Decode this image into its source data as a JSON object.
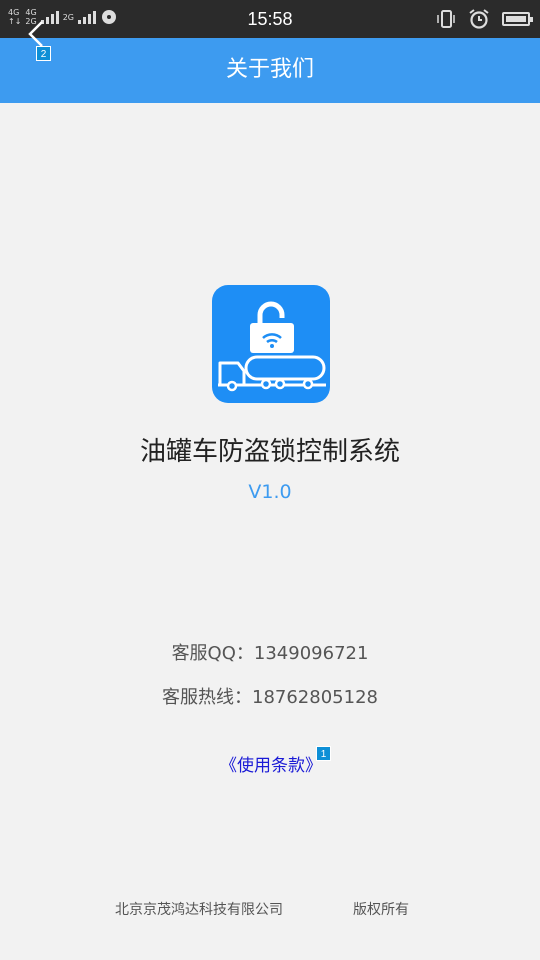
{
  "status_bar": {
    "network_1": "4G",
    "network_2": "4G",
    "network_3": "2G",
    "network_4": "2G",
    "time": "15:58"
  },
  "header": {
    "title": "关于我们",
    "back_badge": "2"
  },
  "app": {
    "icon_name": "oil-tanker-lock-wifi-icon",
    "name": "油罐车防盗锁控制系统",
    "version": "V1.0"
  },
  "contact": {
    "qq": "客服QQ：1349096721",
    "hotline": "客服热线：18762805128"
  },
  "terms": {
    "label": "《使用条款》",
    "badge": "1"
  },
  "footer": {
    "company": "北京京茂鸿达科技有限公司",
    "rights": "版权所有"
  },
  "colors": {
    "accent": "#3d9bf0",
    "status_bar": "#2b2b2b",
    "link": "#1a1ad6",
    "background": "#f2f2f2"
  }
}
